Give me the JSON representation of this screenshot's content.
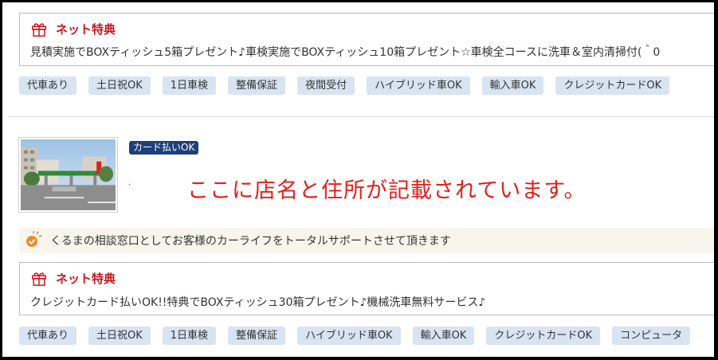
{
  "listing_top": {
    "promo": {
      "icon": "gift-icon",
      "title": "ネット特典",
      "text": "見積実施でBOXティッシュ5箱プレゼント♪車検実施でBOXティッシュ10箱プレゼント☆車検全コースに洗車＆室内清掃付(＾0"
    },
    "tags": [
      "代車あり",
      "土日祝OK",
      "1日車検",
      "整備保証",
      "夜間受付",
      "ハイブリッド車OK",
      "輸入車OK",
      "クレジットカードOK"
    ]
  },
  "listing_bottom": {
    "photo_alt": "shop-photo",
    "badge": "カード払いOK",
    "small_mark": "·",
    "notice": "ここに店名と住所が記載されています。",
    "catchphrase": {
      "icon": "check-badge-icon",
      "text": "くるまの相談窓口としてお客様のカーライフをトータルサポートさせて頂きます"
    },
    "promo": {
      "icon": "gift-icon",
      "title": "ネット特典",
      "text": "クレジットカード払いOK!!特典でBOXティッシュ30箱プレゼント♪機械洗車無料サービス♪"
    },
    "tags": [
      "代車あり",
      "土日祝OK",
      "1日車検",
      "整備保証",
      "ハイブリッド車OK",
      "輸入車OK",
      "クレジットカードOK",
      "コンピュータ"
    ]
  },
  "colors": {
    "accent_red": "#c8161d",
    "notice_red": "#e0201c",
    "tag_bg": "#d8e4f2",
    "badge_bg": "#1d3f7a",
    "catch_bg": "#f8f6ec",
    "check_orange": "#f08a24"
  }
}
